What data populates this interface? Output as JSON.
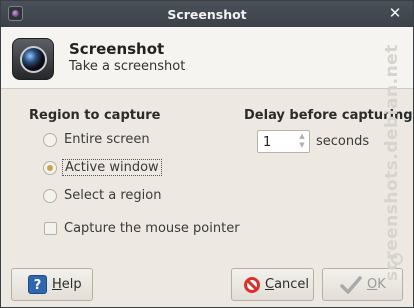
{
  "titlebar": {
    "title": "Screenshot",
    "close_icon": "close-icon"
  },
  "header": {
    "title": "Screenshot",
    "subtitle": "Take a screenshot",
    "icon": "camera-icon"
  },
  "region": {
    "title": "Region to capture",
    "options": [
      {
        "label": "Entire screen",
        "checked": false
      },
      {
        "label": "Active window",
        "checked": true
      },
      {
        "label": "Select a region",
        "checked": false
      }
    ],
    "capture_pointer": {
      "label": "Capture the mouse pointer",
      "checked": false
    }
  },
  "delay": {
    "title": "Delay before capturing",
    "value": "1",
    "unit": "seconds"
  },
  "buttons": {
    "help": {
      "pre": "",
      "mnemonic": "H",
      "post": "elp"
    },
    "cancel": {
      "pre": "",
      "mnemonic": "C",
      "post": "ancel"
    },
    "ok": {
      "pre": "",
      "mnemonic": "O",
      "post": "K"
    }
  },
  "watermark": "screenshots.debian.net",
  "colors": {
    "titlebar": "#3f454c",
    "radio_dot": "#c8a64a",
    "help_blue": "#2e66b0",
    "cancel_red": "#d8322b"
  }
}
